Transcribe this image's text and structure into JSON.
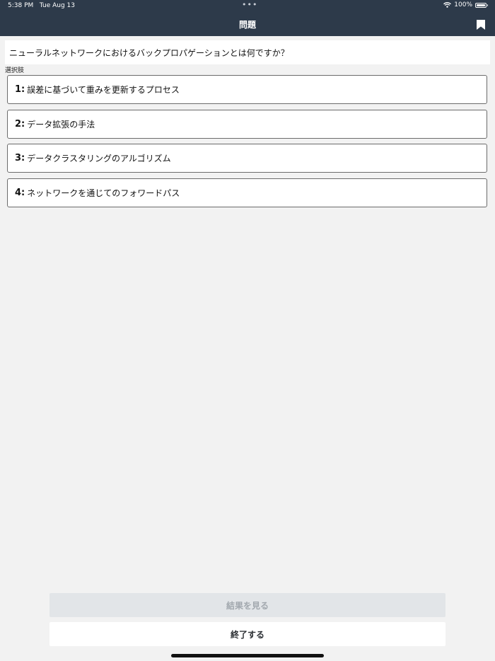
{
  "status_bar": {
    "time": "5:38 PM",
    "date": "Tue Aug 13",
    "battery": "100%",
    "icons": [
      "wifi-icon",
      "battery-icon"
    ]
  },
  "nav": {
    "title": "問題",
    "bookmark_icon": "bookmark-icon"
  },
  "question": {
    "text": "ニューラルネットワークにおけるバックプロパゲーションとは何ですか？"
  },
  "choices_label": "選択肢",
  "choices": [
    {
      "number": "1:",
      "text": "誤差に基づいて重みを更新するプロセス"
    },
    {
      "number": "2:",
      "text": "データ拡張の手法"
    },
    {
      "number": "3:",
      "text": "データクラスタリングのアルゴリズム"
    },
    {
      "number": "4:",
      "text": "ネットワークを通じてのフォワードパス"
    }
  ],
  "buttons": {
    "results": "結果を見る",
    "finish": "終了する"
  },
  "colors": {
    "header_bg": "#2d3a4a",
    "page_bg": "#f2f2f2",
    "disabled_button_bg": "#e2e5e8",
    "disabled_button_text": "#a2a8ae"
  }
}
